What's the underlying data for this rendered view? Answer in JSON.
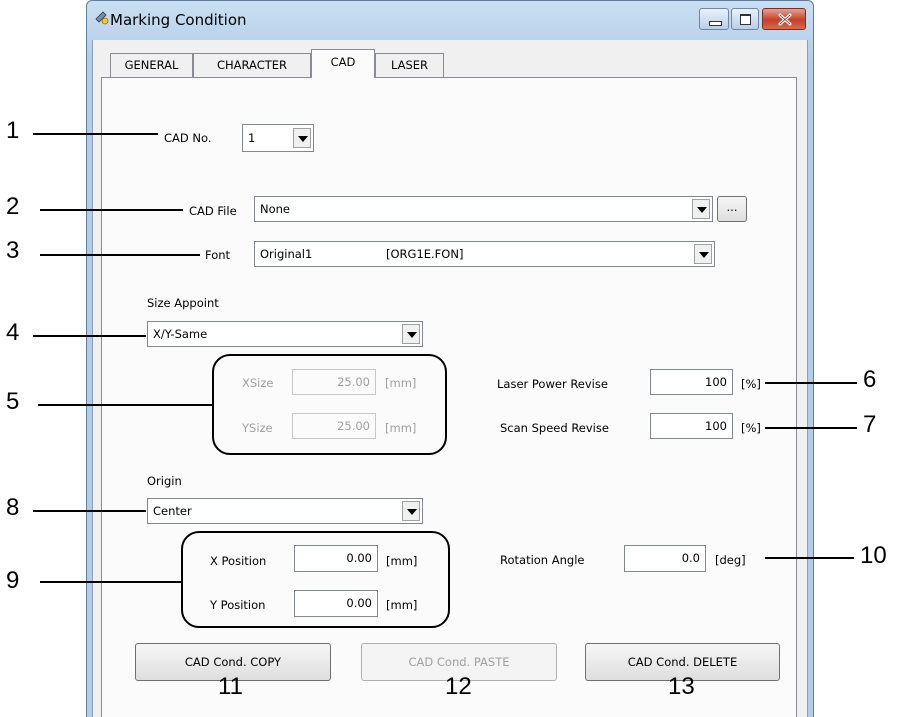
{
  "window": {
    "title": "Marking Condition"
  },
  "tabs": [
    "GENERAL",
    "CHARACTER",
    "CAD",
    "LASER"
  ],
  "active_tab": "CAD",
  "cad_no": {
    "label": "CAD No.",
    "value": "1"
  },
  "cad_file": {
    "label": "CAD File",
    "value": "None",
    "browse_label": "..."
  },
  "font": {
    "label": "Font",
    "name": "Original1",
    "file": "[ORG1E.FON]"
  },
  "size_appoint": {
    "label": "Size Appoint",
    "value": "X/Y-Same"
  },
  "size": {
    "xsize_label": "XSize",
    "xsize_value": "25.00",
    "ysize_label": "YSize",
    "ysize_value": "25.00",
    "unit": "[mm]"
  },
  "laser_power": {
    "label": "Laser Power Revise",
    "value": "100",
    "unit": "[%]"
  },
  "scan_speed": {
    "label": "Scan Speed Revise",
    "value": "100",
    "unit": "[%]"
  },
  "origin": {
    "label": "Origin",
    "value": "Center"
  },
  "position": {
    "x_label": "X Position",
    "x_value": "0.00",
    "y_label": "Y Position",
    "y_value": "0.00",
    "unit": "[mm]"
  },
  "rotation": {
    "label": "Rotation Angle",
    "value": "0.0",
    "unit": "[deg]"
  },
  "buttons": {
    "copy": "CAD Cond. COPY",
    "paste": "CAD Cond. PASTE",
    "delete": "CAD Cond. DELETE"
  },
  "callouts": [
    "1",
    "2",
    "3",
    "4",
    "5",
    "6",
    "7",
    "8",
    "9",
    "10",
    "11",
    "12",
    "13"
  ]
}
